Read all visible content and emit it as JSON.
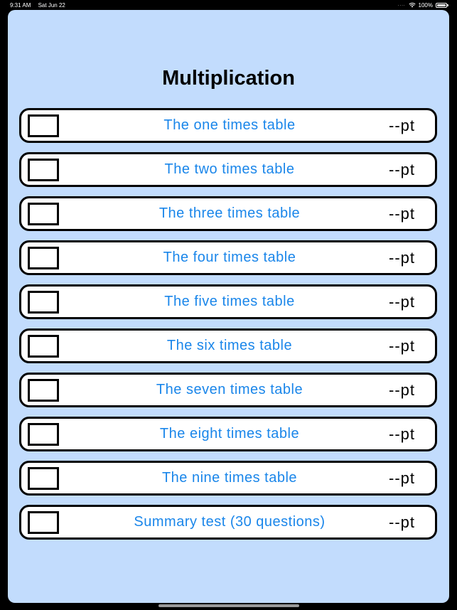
{
  "status_bar": {
    "time": "9:31 AM",
    "date": "Sat Jun 22",
    "signal": "....",
    "battery": "100%"
  },
  "title": "Multiplication",
  "rows": [
    {
      "label": "The one times table",
      "score": "--pt",
      "checked": false
    },
    {
      "label": "The two times table",
      "score": "--pt",
      "checked": false
    },
    {
      "label": "The three times table",
      "score": "--pt",
      "checked": false
    },
    {
      "label": "The four times table",
      "score": "--pt",
      "checked": false
    },
    {
      "label": "The five times table",
      "score": "--pt",
      "checked": false
    },
    {
      "label": "The six times table",
      "score": "--pt",
      "checked": false
    },
    {
      "label": "The seven times table",
      "score": "--pt",
      "checked": false
    },
    {
      "label": "The eight times table",
      "score": "--pt",
      "checked": false
    },
    {
      "label": "The nine times table",
      "score": "--pt",
      "checked": false
    },
    {
      "label": "Summary test (30 questions)",
      "score": "--pt",
      "checked": false
    }
  ],
  "colors": {
    "background": "#c2dcfd",
    "label": "#1a86ea",
    "row_border": "#000000"
  },
  "icons": {
    "wifi": "wifi-icon",
    "battery": "battery-icon",
    "checkbox": "checkbox-icon"
  }
}
